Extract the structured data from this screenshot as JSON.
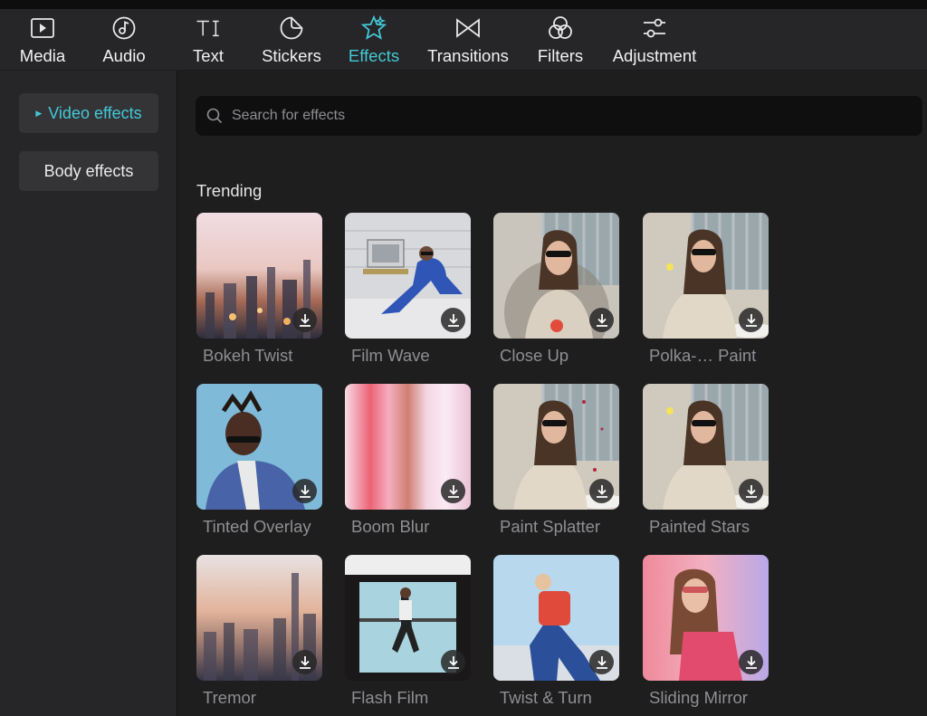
{
  "toolbar": {
    "items": [
      {
        "label": "Media",
        "icon": "media-icon"
      },
      {
        "label": "Audio",
        "icon": "audio-icon"
      },
      {
        "label": "Text",
        "icon": "text-icon"
      },
      {
        "label": "Stickers",
        "icon": "stickers-icon"
      },
      {
        "label": "Effects",
        "icon": "effects-icon",
        "active": true
      },
      {
        "label": "Transitions",
        "icon": "transitions-icon"
      },
      {
        "label": "Filters",
        "icon": "filters-icon"
      },
      {
        "label": "Adjustment",
        "icon": "adjustment-icon"
      }
    ]
  },
  "sidebar": {
    "items": [
      {
        "label": "Video effects",
        "active": true
      },
      {
        "label": "Body effects",
        "active": false
      }
    ]
  },
  "search": {
    "placeholder": "Search for effects"
  },
  "section": {
    "title": "Trending"
  },
  "effects": [
    {
      "name": "Bokeh Twist"
    },
    {
      "name": "Film Wave"
    },
    {
      "name": "Close Up"
    },
    {
      "name": "Polka-… Paint"
    },
    {
      "name": "Tinted Overlay"
    },
    {
      "name": "Boom Blur"
    },
    {
      "name": "Paint Splatter"
    },
    {
      "name": "Painted Stars"
    },
    {
      "name": "Tremor"
    },
    {
      "name": "Flash Film"
    },
    {
      "name": "Twist & Turn"
    },
    {
      "name": "Sliding Mirror"
    }
  ],
  "colors": {
    "accent": "#43c8d6",
    "panel": "#262628",
    "background": "#1e1e1f",
    "search_bg": "#0f0f10"
  }
}
